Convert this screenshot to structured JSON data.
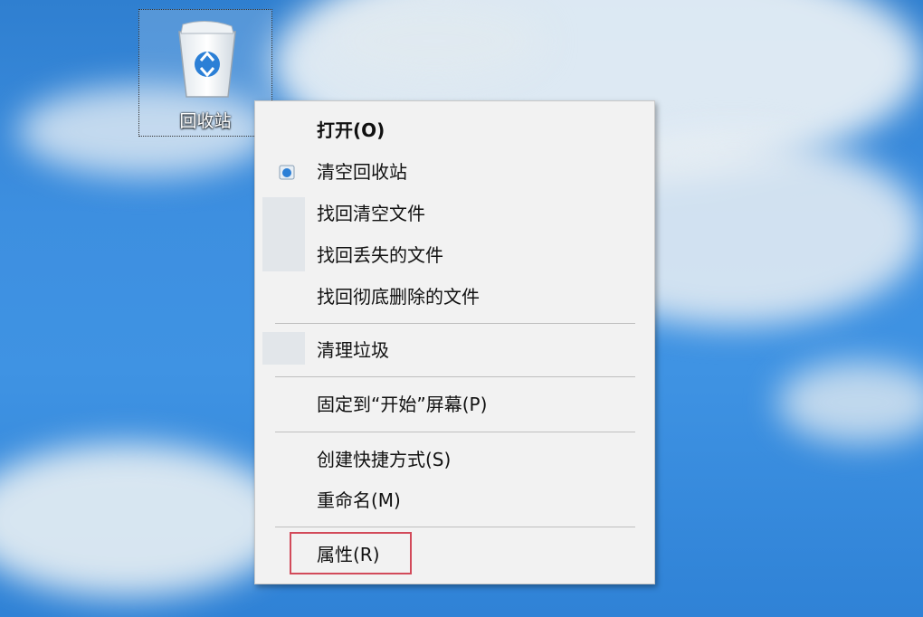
{
  "desktop": {
    "recycle_bin_label": "回收站"
  },
  "menu": {
    "items": [
      {
        "label": "打开(O)",
        "bold": true
      },
      {
        "label": "清空回收站",
        "icon": "recycle-bin-icon"
      },
      {
        "label": "找回清空文件"
      },
      {
        "label": "找回丢失的文件"
      },
      {
        "label": "找回彻底删除的文件"
      },
      {
        "label": "清理垃圾"
      },
      {
        "label": "固定到“开始”屏幕(P)"
      },
      {
        "label": "创建快捷方式(S)"
      },
      {
        "label": "重命名(M)"
      },
      {
        "label": "属性(R)",
        "highlighted": true
      }
    ]
  },
  "colors": {
    "highlight_border": "#d24a5a",
    "menu_bg": "#f2f2f2"
  }
}
